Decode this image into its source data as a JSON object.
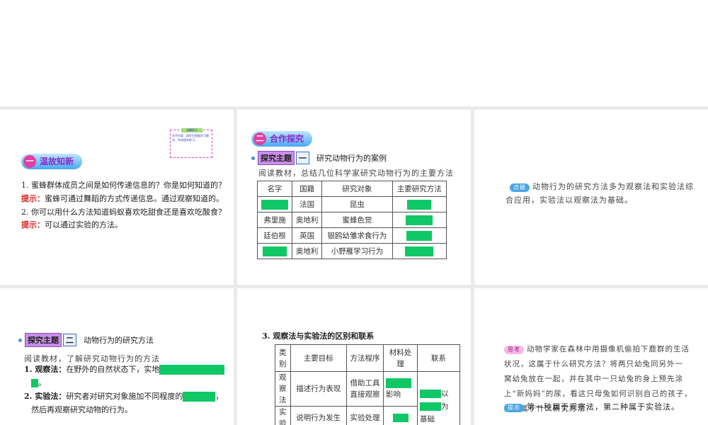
{
  "slide1": {
    "tip_box": {
      "title": "温馨提示",
      "text": "本节内容...请学生根据学习情况，完成相关练习。"
    },
    "section_title": "温故知新",
    "section_num": "一",
    "q1": "1. 蜜蜂群体成员之间是如何传递信息的？你是如何知道的？",
    "hint_label": "提示：",
    "a1": "蜜蜂可通过舞蹈的方式传递信息。通过观察知道的。",
    "q2": "2. 你可以用什么方法知道蚂蚁喜欢吃甜食还是喜欢吃酸食？",
    "a2": "可以通过实验的方法。"
  },
  "slide2": {
    "section_title": "合作探究",
    "section_num": "二",
    "topic_tag": "探究主题",
    "topic_num": "一",
    "topic_title": "研究动物行为的案例",
    "intro": "阅读教材，总结几位科学家研究动物行为的主要方法",
    "headers": [
      "名字",
      "国籍",
      "研究对象",
      "主要研究方法"
    ],
    "rows": [
      [
        "",
        "法国",
        "昆虫",
        ""
      ],
      [
        "弗里施",
        "奥地利",
        "蜜蜂色觉",
        ""
      ],
      [
        "廷伯根",
        "英国",
        "银鸥幼雏求食行为",
        ""
      ],
      [
        "",
        "奥地利",
        "小野雁学习行为",
        ""
      ]
    ]
  },
  "slide3": {
    "label": "点拨",
    "text1": "动物行为的研究方法多为观察法和实验法综",
    "text2": "合应用，实验法以观察法为基础。"
  },
  "slide4": {
    "topic_tag": "探究主题",
    "topic_num": "二",
    "topic_title": "动物行为的研究方法",
    "intro": "阅读教材，了解研究动物行为的方法",
    "item1_label": "1. 观察法：",
    "item1_text": "在野外的自然状态下，实地",
    "item1_end": "。",
    "item2_label": "2. 实验法：",
    "item2_text": "研究者对研究对象施加不同程度的",
    "item2_end": "，",
    "item2_cont": "然后再观察研究动物的行为。"
  },
  "slide5": {
    "title": "3. 观察法与实验法的区别和联系",
    "headers": [
      "类别",
      "主要目标",
      "方法程序",
      "材料处理",
      "联系"
    ],
    "rows": [
      [
        "观察法",
        "描述行为表现",
        "借助工具直接观察",
        "影响"
      ],
      [
        "实验法",
        "说明行为发生原因",
        "实验处理后再观察",
        "影响"
      ]
    ],
    "link": {
      "yi": "以",
      "wei": "为",
      "jichu": "基础"
    }
  },
  "slide6": {
    "label": "思考",
    "lines": [
      "动物学家在森林中用摄像机偷拍下鹿群的生活",
      "状况，这属于什么研究方法？将两只幼兔同另外一",
      "窝幼兔放在一起，并在其中一只幼兔的身上预先涂",
      "上“新妈妈”的尿，看这只母兔如何识别自己的孩子，",
      "这又属于什么研究方法？"
    ],
    "hint_label": "提示",
    "answer": "第一种属于观察法，第二种属于实验法。"
  }
}
